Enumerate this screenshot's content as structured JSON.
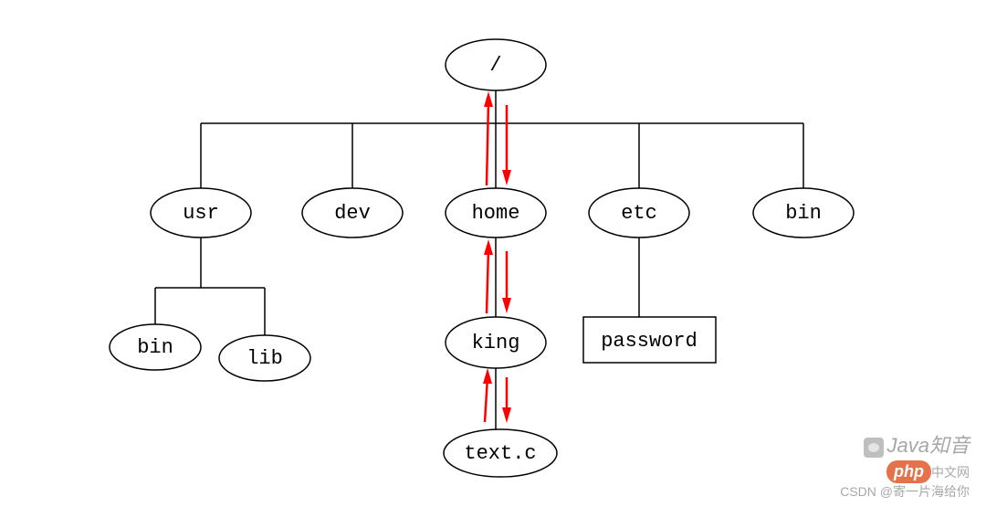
{
  "diagram": {
    "type": "tree",
    "description": "Linux filesystem hierarchy tree with traversal arrows between root, home, king, text.c",
    "root": {
      "label": "/",
      "shape": "ellipse"
    },
    "children": [
      {
        "id": "usr",
        "label": "usr",
        "shape": "ellipse",
        "children": [
          {
            "id": "usr-bin",
            "label": "bin",
            "shape": "ellipse"
          },
          {
            "id": "usr-lib",
            "label": "lib",
            "shape": "ellipse"
          }
        ]
      },
      {
        "id": "dev",
        "label": "dev",
        "shape": "ellipse"
      },
      {
        "id": "home",
        "label": "home",
        "shape": "ellipse",
        "children": [
          {
            "id": "king",
            "label": "king",
            "shape": "ellipse",
            "children": [
              {
                "id": "textc",
                "label": "text.c",
                "shape": "ellipse"
              }
            ]
          }
        ]
      },
      {
        "id": "etc",
        "label": "etc",
        "shape": "ellipse",
        "children": [
          {
            "id": "password",
            "label": "password",
            "shape": "rect"
          }
        ]
      },
      {
        "id": "bin",
        "label": "bin",
        "shape": "ellipse"
      }
    ],
    "arrows": [
      {
        "from": "home",
        "to": "root",
        "dir": "up"
      },
      {
        "from": "root",
        "to": "home",
        "dir": "down"
      },
      {
        "from": "king",
        "to": "home",
        "dir": "up"
      },
      {
        "from": "home",
        "to": "king",
        "dir": "down"
      },
      {
        "from": "textc",
        "to": "king",
        "dir": "up"
      },
      {
        "from": "king",
        "to": "textc",
        "dir": "down"
      }
    ]
  },
  "watermark": {
    "line1_prefix_icon": "wechat",
    "line1": "Java知音",
    "badge": "php",
    "suffix": "中文网",
    "line2": "CSDN @寄一片海给你"
  }
}
